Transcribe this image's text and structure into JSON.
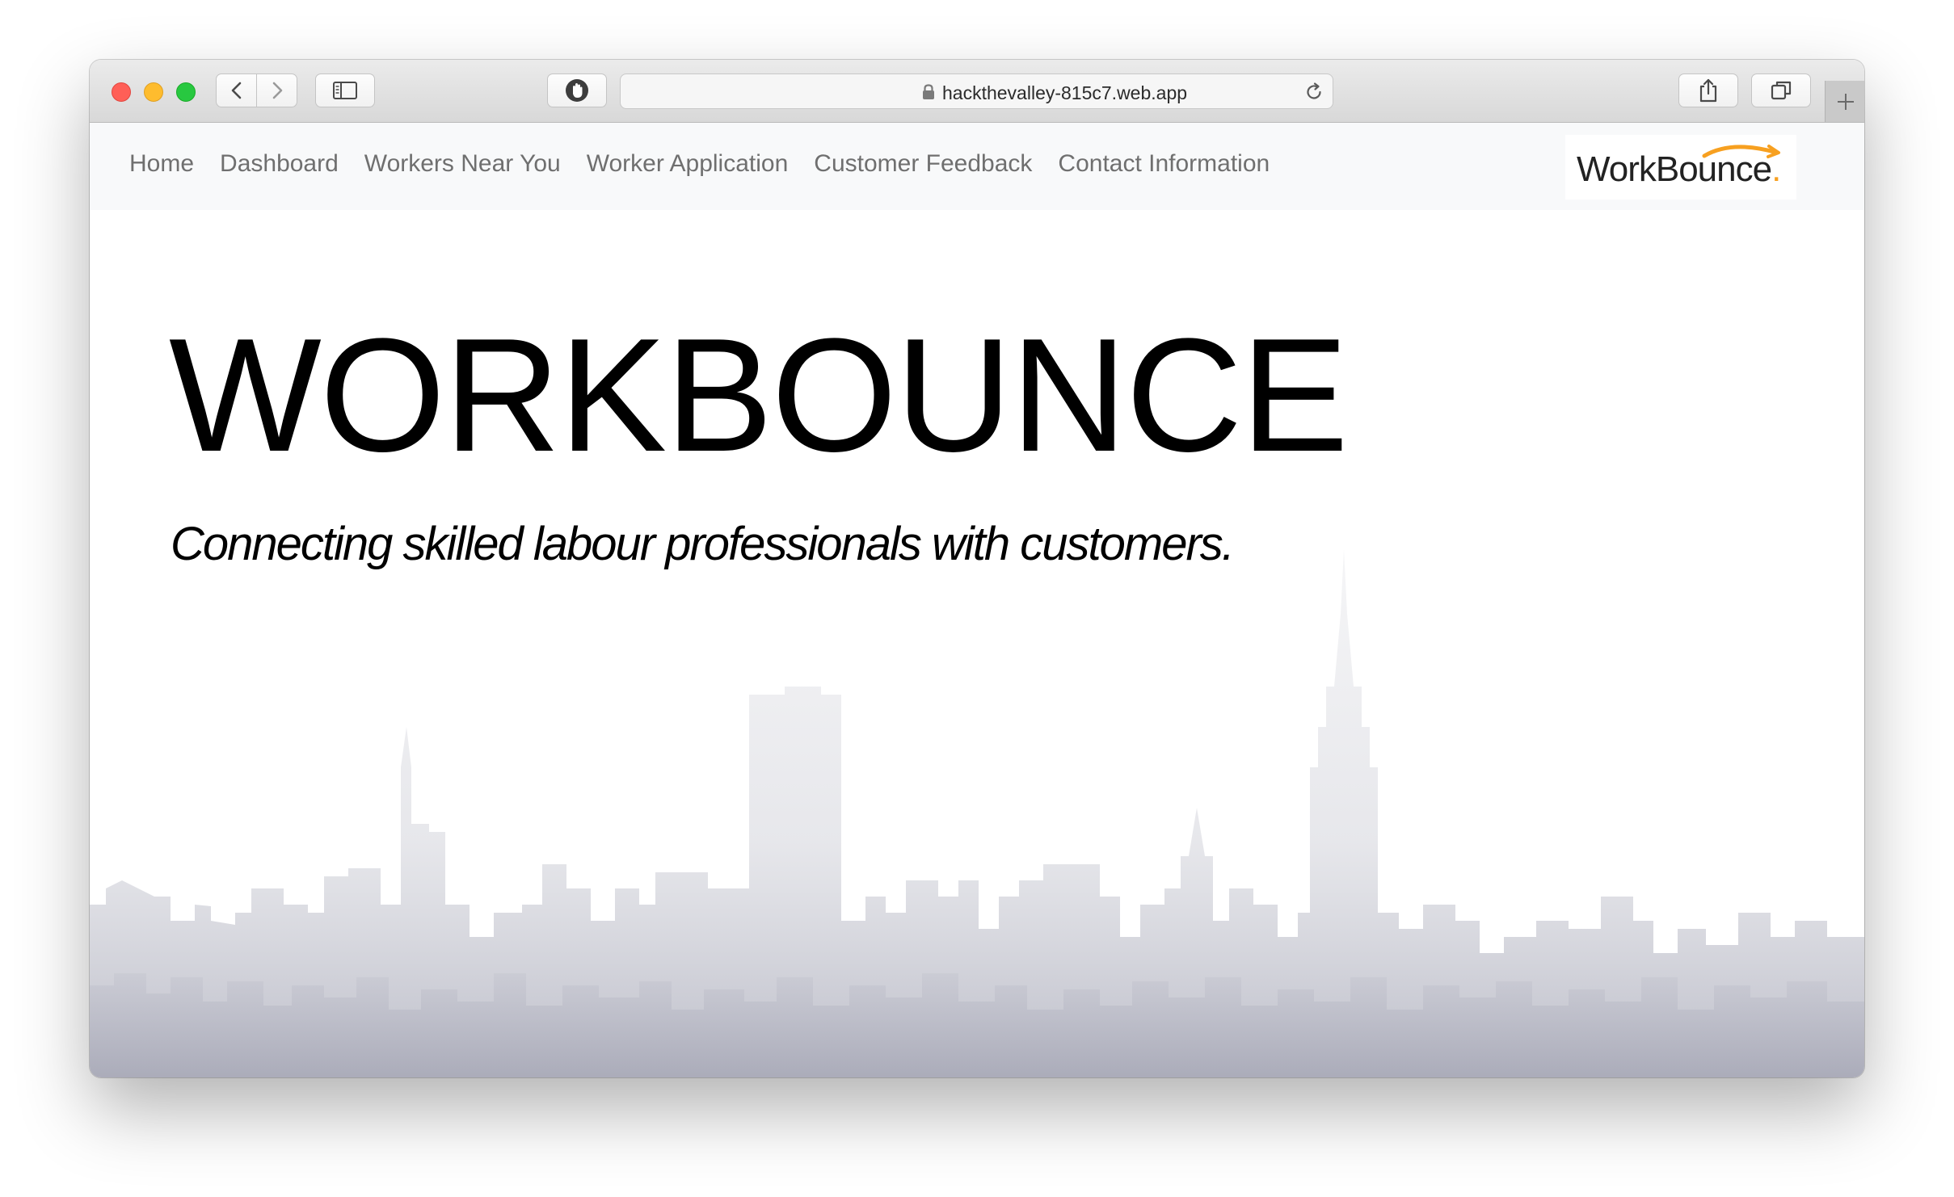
{
  "browser": {
    "url": "hackthevalley-815c7.web.app"
  },
  "navbar": {
    "links": [
      "Home",
      "Dashboard",
      "Workers Near You",
      "Worker Application",
      "Customer Feedback",
      "Contact Information"
    ],
    "logo": {
      "text_prefix": "Work",
      "text_suffix": "Bounce",
      "accent_color": "#f7a020"
    }
  },
  "hero": {
    "title": "WORKBOUNCE",
    "subtitle": "Connecting skilled labour professionals with customers."
  },
  "colors": {
    "navbar_bg": "#f8f9fa",
    "nav_link": "#6f6f6f",
    "skyline": "#c9cad3"
  }
}
